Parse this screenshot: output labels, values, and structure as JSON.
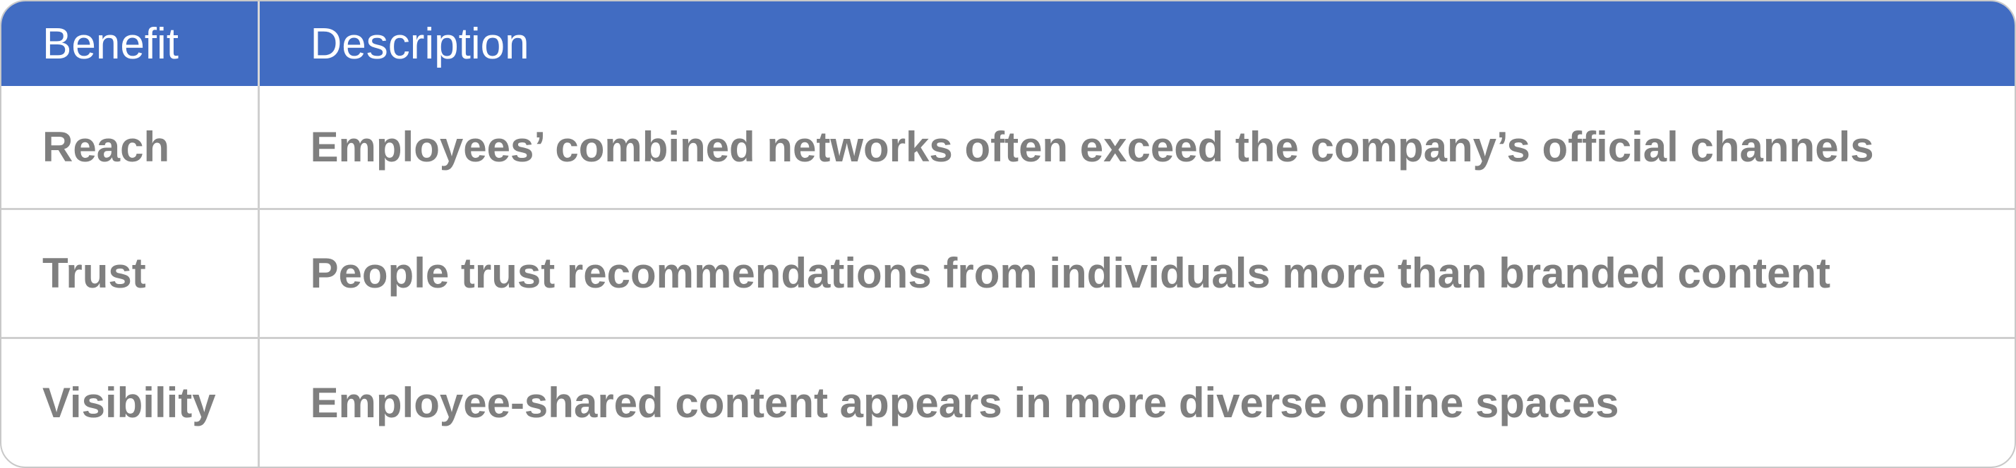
{
  "table": {
    "headers": {
      "benefit": "Benefit",
      "description": "Description"
    },
    "rows": [
      {
        "benefit": "Reach",
        "description": "Employees’ combined networks often exceed the company’s official channels"
      },
      {
        "benefit": "Trust",
        "description": "People trust recommendations from individuals more than branded content"
      },
      {
        "benefit": "Visibility",
        "description": "Employee-shared content appears in more diverse online spaces"
      }
    ]
  },
  "colors": {
    "header_bg": "#416cc2",
    "header_text": "#ffffff",
    "body_text": "#7f7f7f",
    "border": "#cfcfcf"
  }
}
